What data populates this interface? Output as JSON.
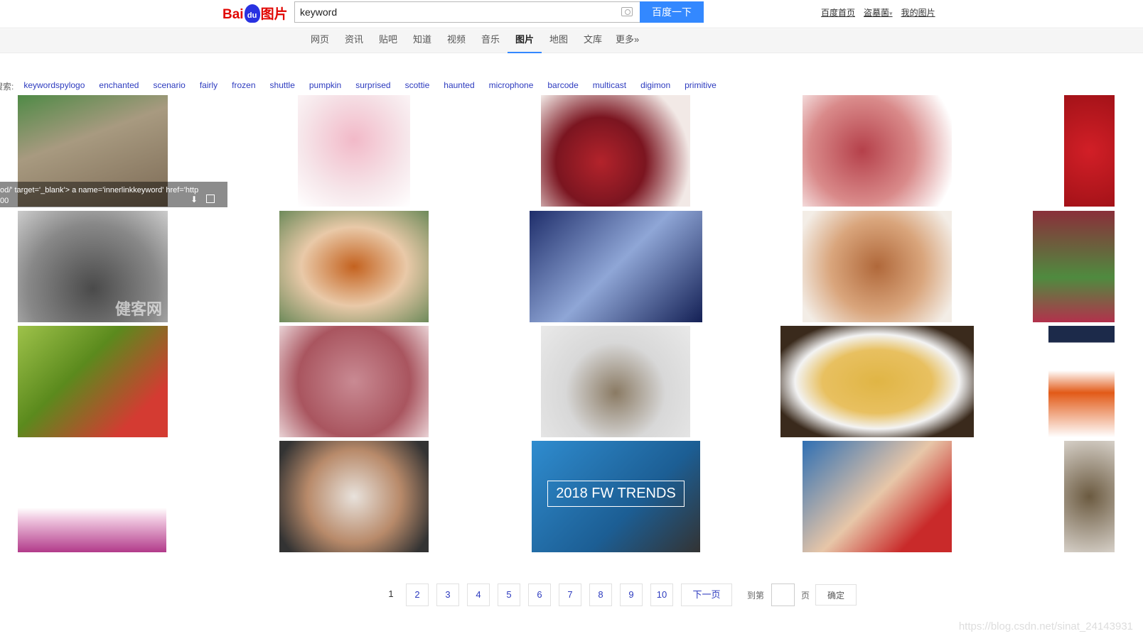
{
  "header": {
    "logo_text": "Bai du 图片",
    "search_value": "keyword",
    "search_button": "百度一下",
    "links": [
      "百度首页",
      "盗墓菌",
      "我的图片"
    ]
  },
  "nav": {
    "items": [
      "网页",
      "资讯",
      "贴吧",
      "知道",
      "视频",
      "音乐",
      "图片",
      "地图",
      "文库",
      "更多»"
    ],
    "active": "图片"
  },
  "related": {
    "label": "搜索:",
    "keywords": [
      "keywordspylogo",
      "enchanted",
      "scenario",
      "fairly",
      "frozen",
      "shuttle",
      "pumpkin",
      "surprised",
      "scottie",
      "haunted",
      "microphone",
      "barcode",
      "multicast",
      "digimon",
      "primitive"
    ]
  },
  "hover": {
    "line1": "od/' target='_blank'> a name='innerlinkkeyword' href='http",
    "line2": "00",
    "icons": [
      "download-icon",
      "zoom-icon"
    ]
  },
  "images": {
    "trend_text": "2018 FW TRENDS",
    "watermark_text": "健客网"
  },
  "pager": {
    "current": "1",
    "pages": [
      "2",
      "3",
      "4",
      "5",
      "6",
      "7",
      "8",
      "9",
      "10"
    ],
    "next": "下一页",
    "goto_label": "到第",
    "page_unit": "页",
    "confirm": "确定"
  },
  "watermark": "https://blog.csdn.net/sinat_24143931",
  "colors": {
    "accent": "#3388ff",
    "link": "#2d3bbf",
    "logo_red": "#e10602",
    "logo_blue": "#2932e1"
  }
}
